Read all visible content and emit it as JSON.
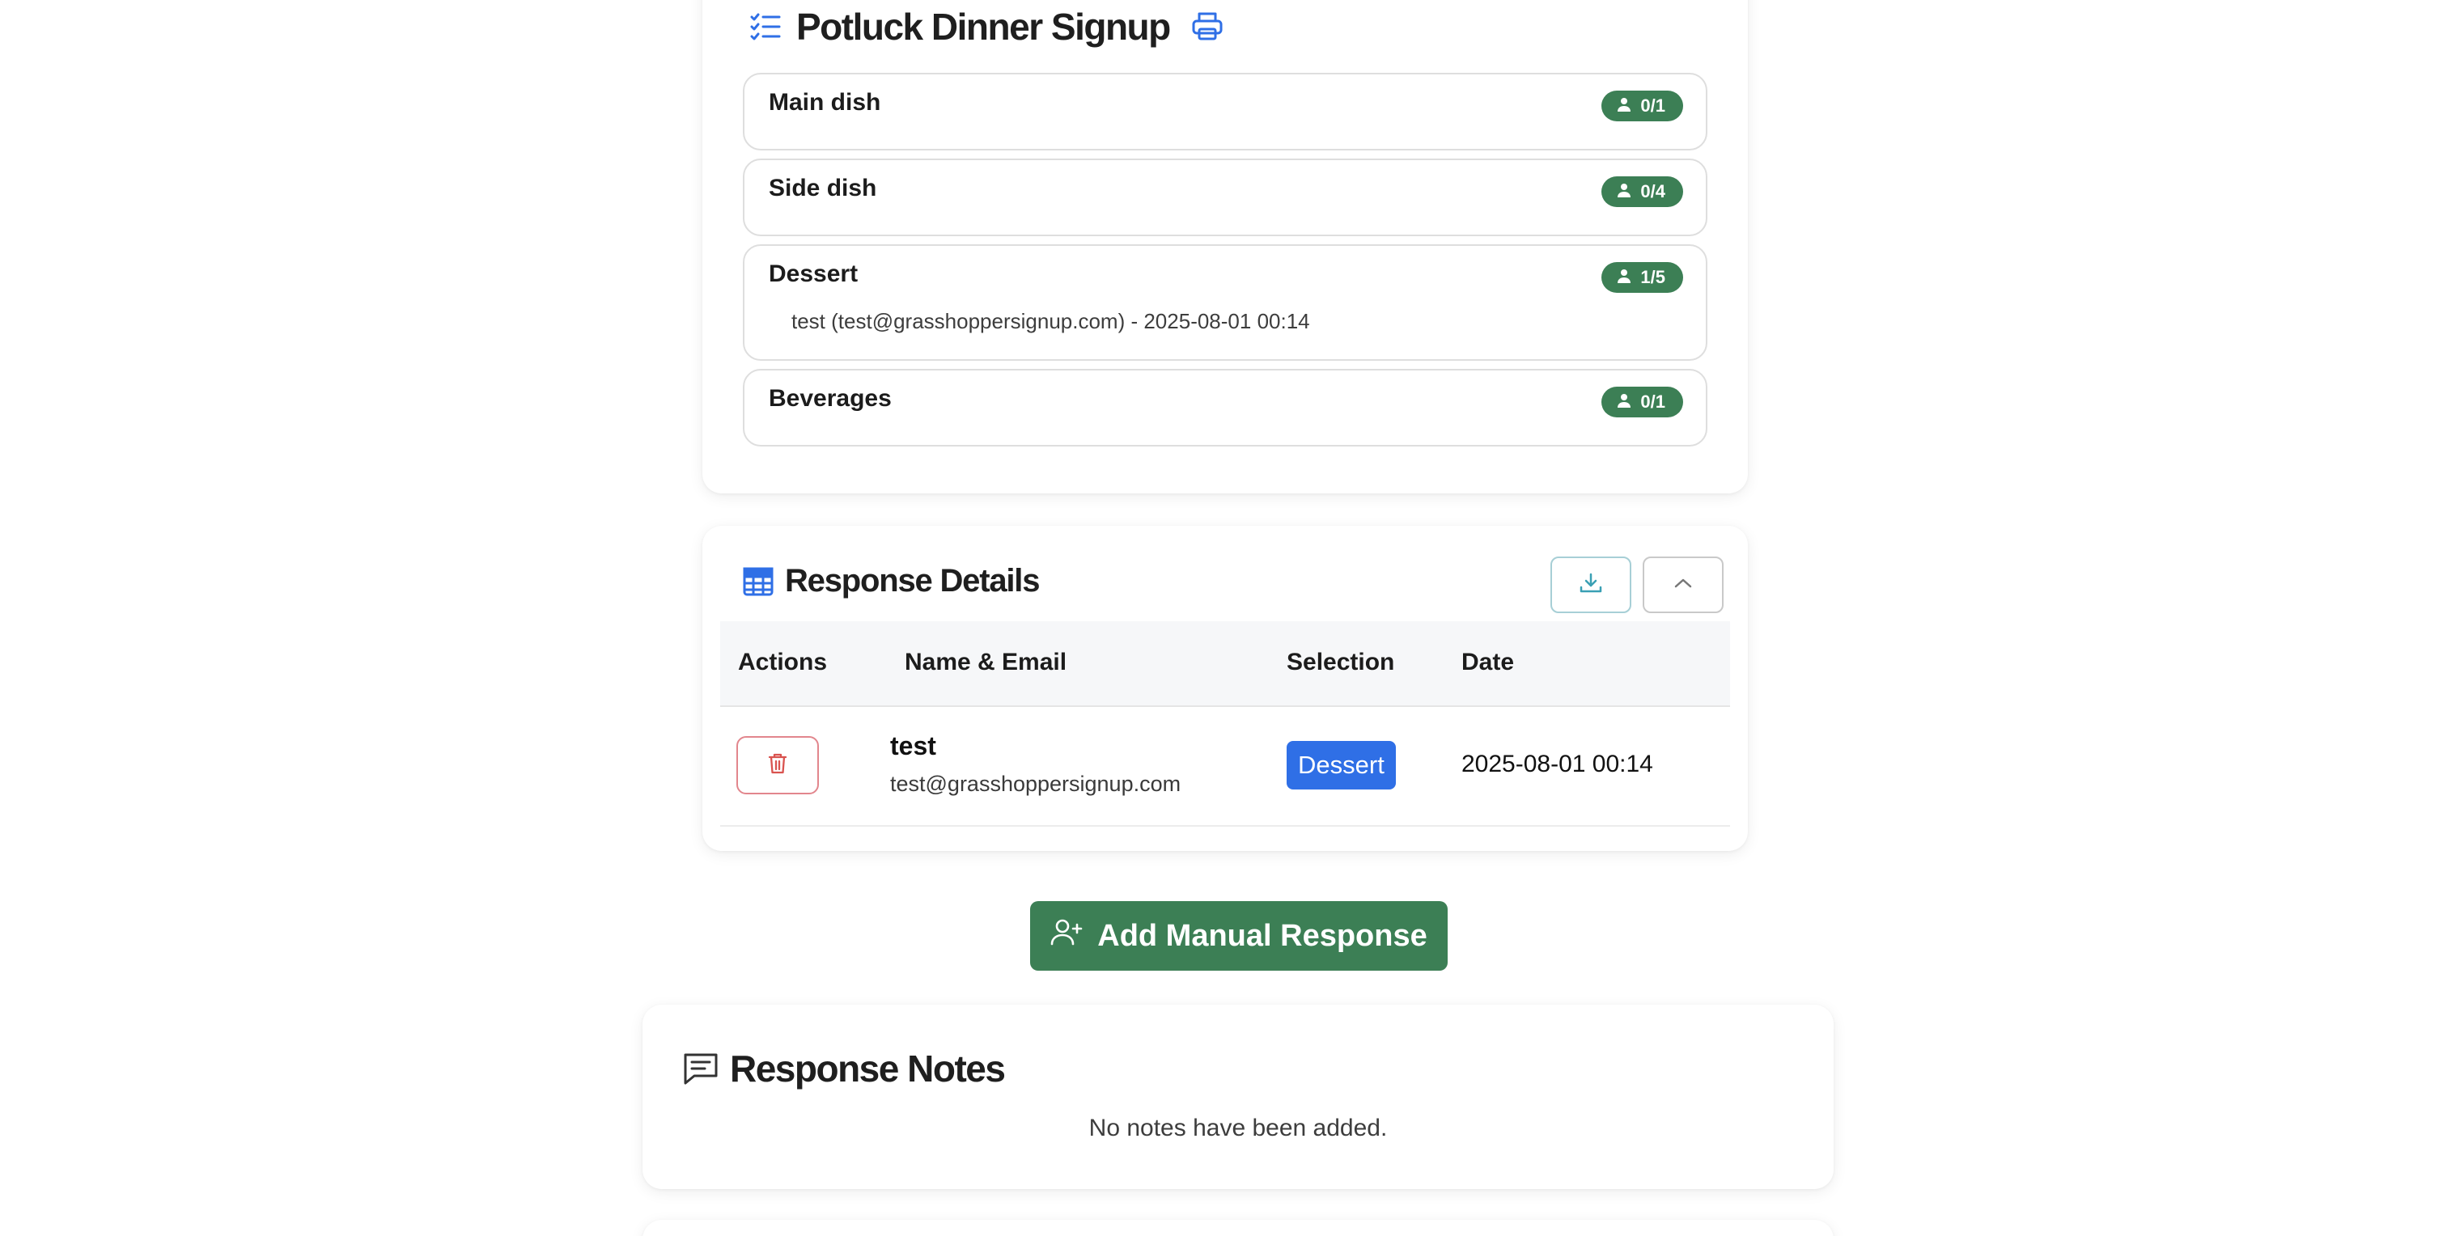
{
  "signup": {
    "title": "Potluck Dinner Signup",
    "slots": [
      {
        "name": "Main dish",
        "count": "0/1",
        "entries": []
      },
      {
        "name": "Side dish",
        "count": "0/4",
        "entries": []
      },
      {
        "name": "Dessert",
        "count": "1/5",
        "entries": [
          "test (test@grasshoppersignup.com) - 2025-08-01 00:14"
        ]
      },
      {
        "name": "Beverages",
        "count": "0/1",
        "entries": []
      }
    ]
  },
  "details": {
    "title": "Response Details",
    "columns": [
      "Actions",
      "Name & Email",
      "Selection",
      "Date"
    ],
    "rows": [
      {
        "name": "test",
        "email": "test@grasshoppersignup.com",
        "selection": "Dessert",
        "date": "2025-08-01 00:14"
      }
    ]
  },
  "add_button": {
    "label": "Add Manual Response"
  },
  "notes": {
    "title": "Response Notes",
    "empty_text": "No notes have been added."
  },
  "colors": {
    "accent_blue": "#2f6fe6",
    "success_green": "#3c7f55",
    "danger_red": "#d9534f"
  }
}
